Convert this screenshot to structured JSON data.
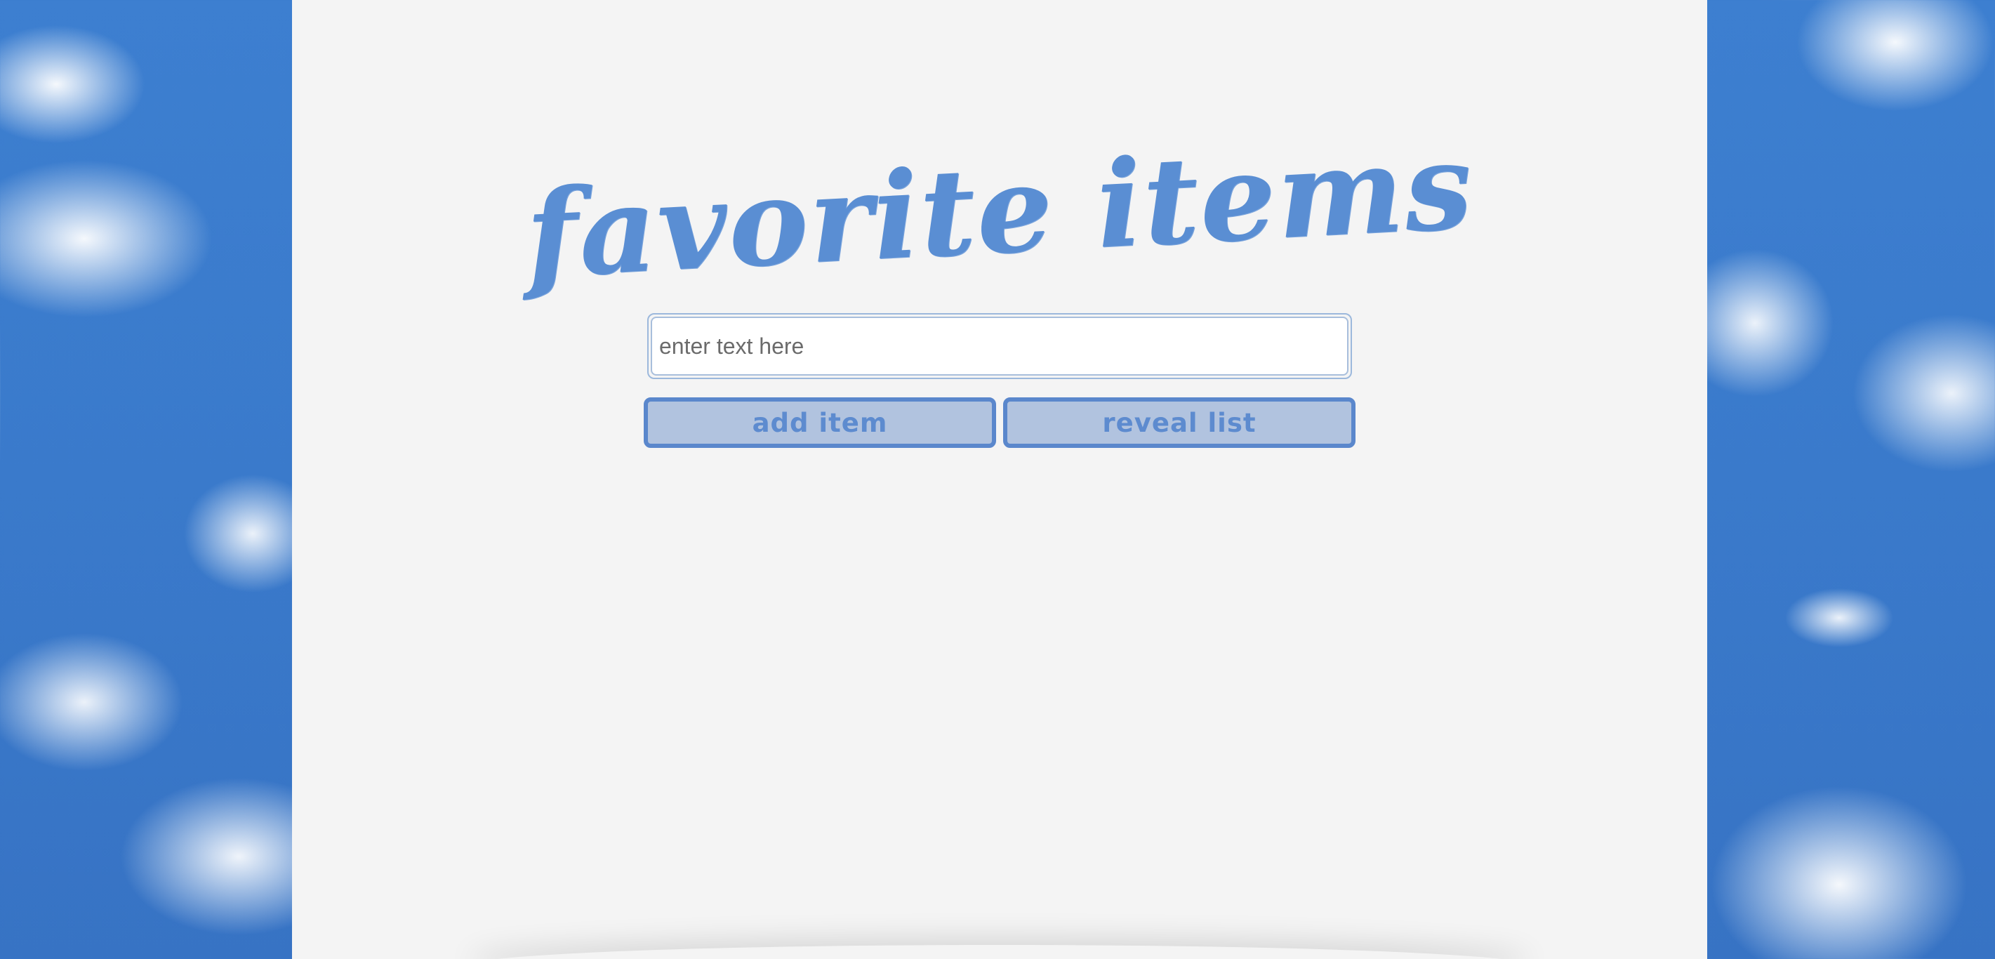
{
  "header": {
    "title": "favorite items"
  },
  "form": {
    "input_placeholder": "enter text here",
    "input_value": ""
  },
  "buttons": {
    "add_label": "add item",
    "reveal_label": "reveal list"
  },
  "colors": {
    "accent": "#5a87cc",
    "button_fill": "#b1c3df",
    "panel_bg": "#f4f4f4",
    "sky": "#3d7fd0"
  },
  "background": {
    "description_icon": "cloud-sky-icon"
  }
}
